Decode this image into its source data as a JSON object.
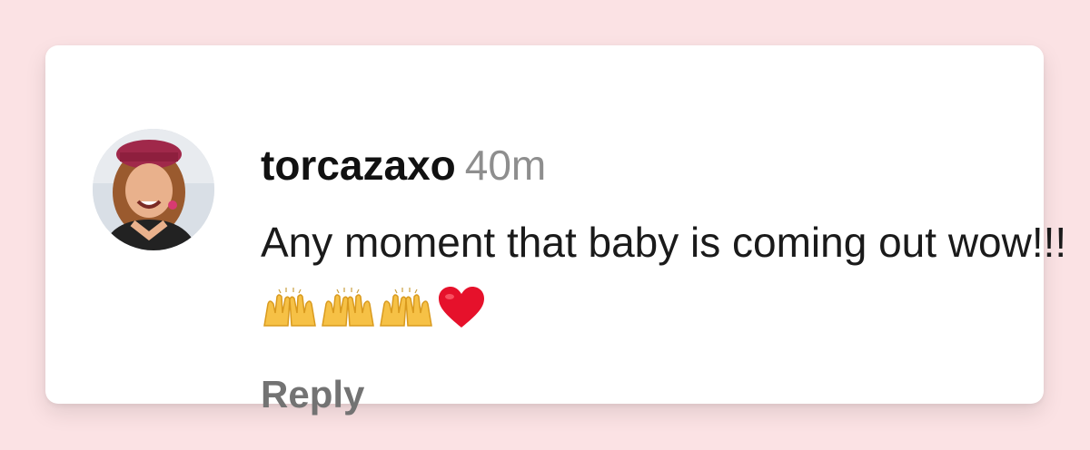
{
  "comment": {
    "username": "torcazaxo",
    "time": "40m",
    "text": "Any moment that baby is coming out wow!!!",
    "emojis": [
      "raising-hands-icon",
      "raising-hands-icon",
      "raising-hands-icon",
      "red-heart-icon"
    ],
    "reply_label": "Reply"
  },
  "colors": {
    "background": "#fbe2e4",
    "card": "#ffffff",
    "username": "#111111",
    "timestamp": "#8e8e8e",
    "reply": "#737373",
    "heart": "#e6112b",
    "hands": "#f6c146"
  }
}
